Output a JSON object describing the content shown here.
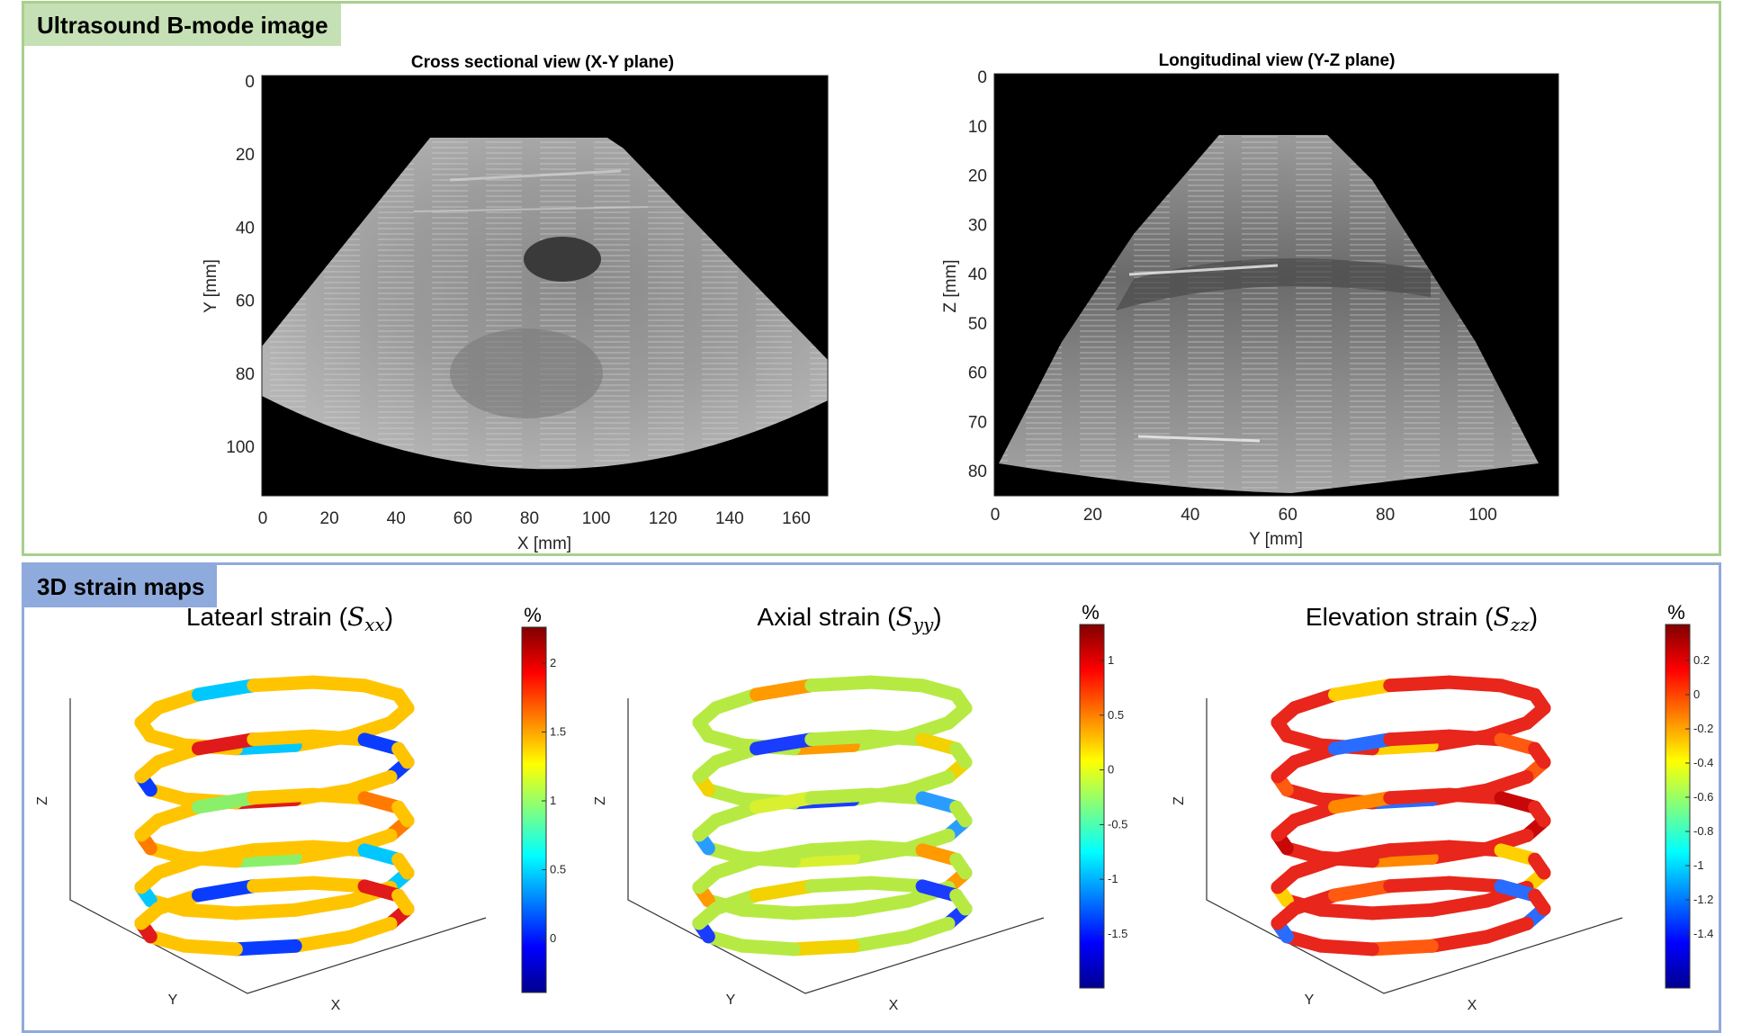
{
  "panels": {
    "bmode_label": "Ultrasound B-mode image",
    "strain_label": "3D strain maps"
  },
  "bmode_views": [
    {
      "title": "Cross sectional view (X-Y plane)",
      "xlabel": "X [mm]",
      "ylabel": "Y [mm]",
      "x_ticks": [
        "0",
        "20",
        "40",
        "60",
        "80",
        "100",
        "120",
        "140",
        "160"
      ],
      "y_ticks": [
        "0",
        "20",
        "40",
        "60",
        "80",
        "100"
      ]
    },
    {
      "title": "Longitudinal view (Y-Z plane)",
      "xlabel": "Y [mm]",
      "ylabel": "Z [mm]",
      "x_ticks": [
        "0",
        "20",
        "40",
        "60",
        "80",
        "100"
      ],
      "y_ticks": [
        "0",
        "10",
        "20",
        "30",
        "40",
        "50",
        "60",
        "70",
        "80"
      ]
    }
  ],
  "strain_maps": [
    {
      "title_prefix": "Latearl strain (",
      "symbol": "S",
      "subscript": "xx",
      "title_suffix": ")",
      "unit": "%",
      "axis_z": "Z",
      "axis_y": "Y",
      "axis_x": "X",
      "colorbar_ticks": [
        "2",
        "1.5",
        "1",
        "0.5",
        "0"
      ],
      "dominant_color": "#ffc400"
    },
    {
      "title_prefix": "Axial strain (",
      "symbol": "S",
      "subscript": "yy",
      "title_suffix": ")",
      "unit": "%",
      "axis_z": "Z",
      "axis_y": "Y",
      "axis_x": "X",
      "colorbar_ticks": [
        "1",
        "0.5",
        "0",
        "-0.5",
        "-1",
        "-1.5"
      ],
      "dominant_color": "#b6ea43"
    },
    {
      "title_prefix": "Elevation strain (",
      "symbol": "S",
      "subscript": "zz",
      "title_suffix": ")",
      "unit": "%",
      "axis_z": "Z",
      "axis_y": "Y",
      "axis_x": "X",
      "colorbar_ticks": [
        "0.2",
        "0",
        "-0.2",
        "-0.4",
        "-0.6",
        "-0.8",
        "-1",
        "-1.2",
        "-1.4"
      ],
      "dominant_color": "#e8261b"
    }
  ]
}
